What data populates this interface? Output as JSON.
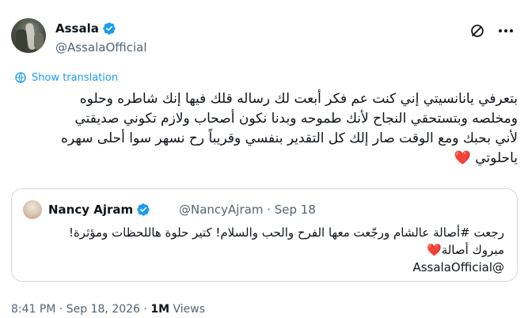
{
  "author": {
    "name": "Assala",
    "handle": "@AssalaOfficial"
  },
  "translate_label": "Show translation",
  "tweet_text": "بتعرفي يانانسيتي إني كنت عم فكر أبعت لك رساله قلك فيها إنك شاطره وحلوه\nومخلصه وبتستحقي النجاح لأنك طموحه وبدنا نكون أصحاب ولازم تكوني صديقتي\nلأني بحبك ومع الوقت صار إلك كل التقدير بنفسي وقريباً رح نسهر سوا أحلى سهره\nياحلوتي",
  "tweet_emoji": "❤️",
  "quoted": {
    "name": "Nancy Ajram",
    "handle": "@NancyAjram",
    "date": "Sep 18",
    "text_line1": "رجعت #أصالة عالشام ورجّعت معها الفرح والحب والسلام! كتير حلوة هاللحظات ومؤثرة!",
    "text_line2": "مبروك أصالة",
    "text_emoji": "❤️",
    "text_line3": "@AssalaOfficial"
  },
  "footer": {
    "time": "8:41 PM",
    "date": "Sep 18, 2026",
    "views_count": "1M",
    "views_label": "Views"
  },
  "colors": {
    "accent": "#1d9bf0",
    "secondary_text": "#536471",
    "border": "#cfd9de"
  }
}
